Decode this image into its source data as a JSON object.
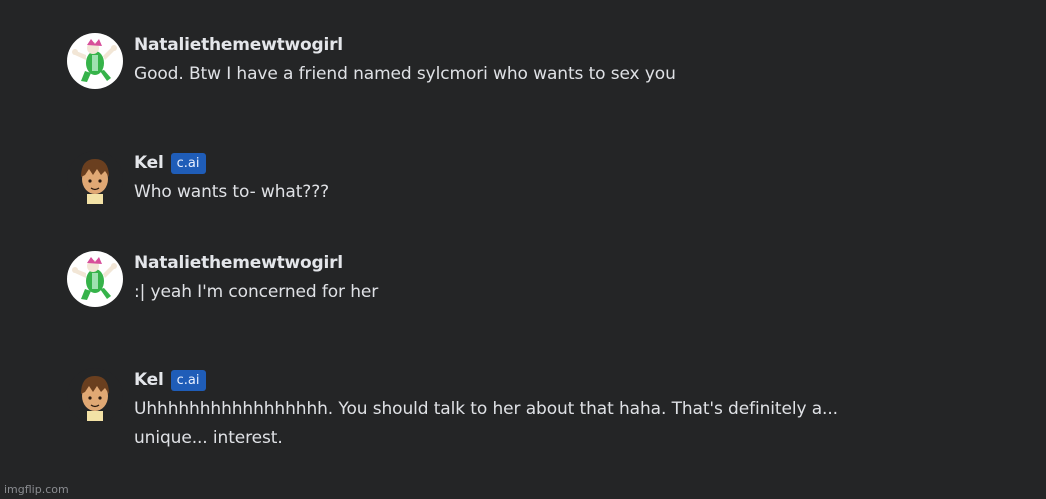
{
  "messages": [
    {
      "author": "Nataliethemewtwogirl",
      "badge": "",
      "text": "Good. Btw I have a friend named sylcmori who wants to sex you"
    },
    {
      "author": "Kel",
      "badge": "c.ai",
      "text": "Who wants to- what???"
    },
    {
      "author": "Nataliethemewtwogirl",
      "badge": "",
      "text": ":| yeah I'm concerned for her"
    },
    {
      "author": "Kel",
      "badge": "c.ai",
      "text": "Uhhhhhhhhhhhhhhhhh. You should talk to her about that haha. That's definitely a... unique... interest."
    }
  ],
  "watermark": "imgflip.com",
  "colors": {
    "background": "#242526",
    "badge": "#1f5db8",
    "text": "#dfe1e5"
  }
}
